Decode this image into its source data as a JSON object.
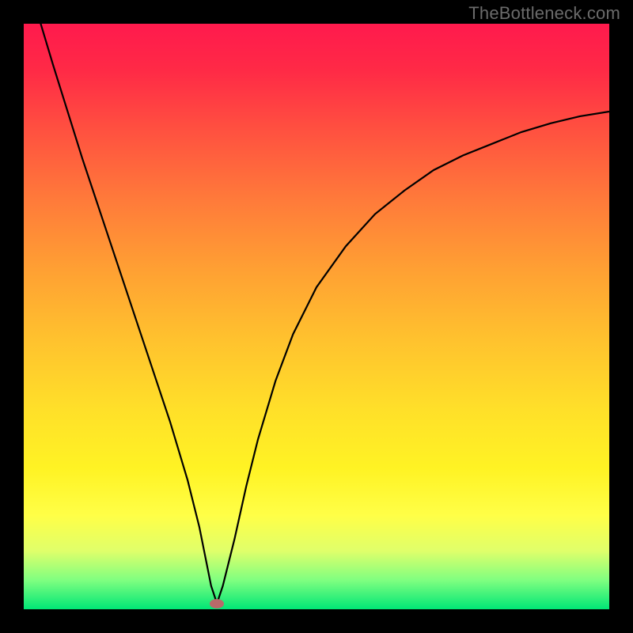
{
  "watermark": "TheBottleneck.com",
  "chart_data": {
    "type": "line",
    "title": "",
    "xlabel": "",
    "ylabel": "",
    "x": [
      0,
      2,
      5,
      10,
      15,
      20,
      25,
      28,
      30,
      31,
      32,
      33,
      34,
      36,
      38,
      40,
      43,
      46,
      50,
      55,
      60,
      65,
      70,
      75,
      80,
      85,
      90,
      95,
      100
    ],
    "values": [
      110,
      103,
      93,
      77,
      62,
      47,
      32,
      22,
      14,
      9,
      4,
      1,
      4,
      12,
      21,
      29,
      39,
      47,
      55,
      62,
      67.5,
      71.5,
      75,
      77.5,
      79.5,
      81.5,
      83,
      84.2,
      85
    ],
    "xlim": [
      0,
      100
    ],
    "ylim": [
      0,
      100
    ],
    "marker": {
      "x": 33,
      "y": 1
    },
    "background_gradient": [
      "#ff1a4d",
      "#ffff47",
      "#00e676"
    ]
  }
}
